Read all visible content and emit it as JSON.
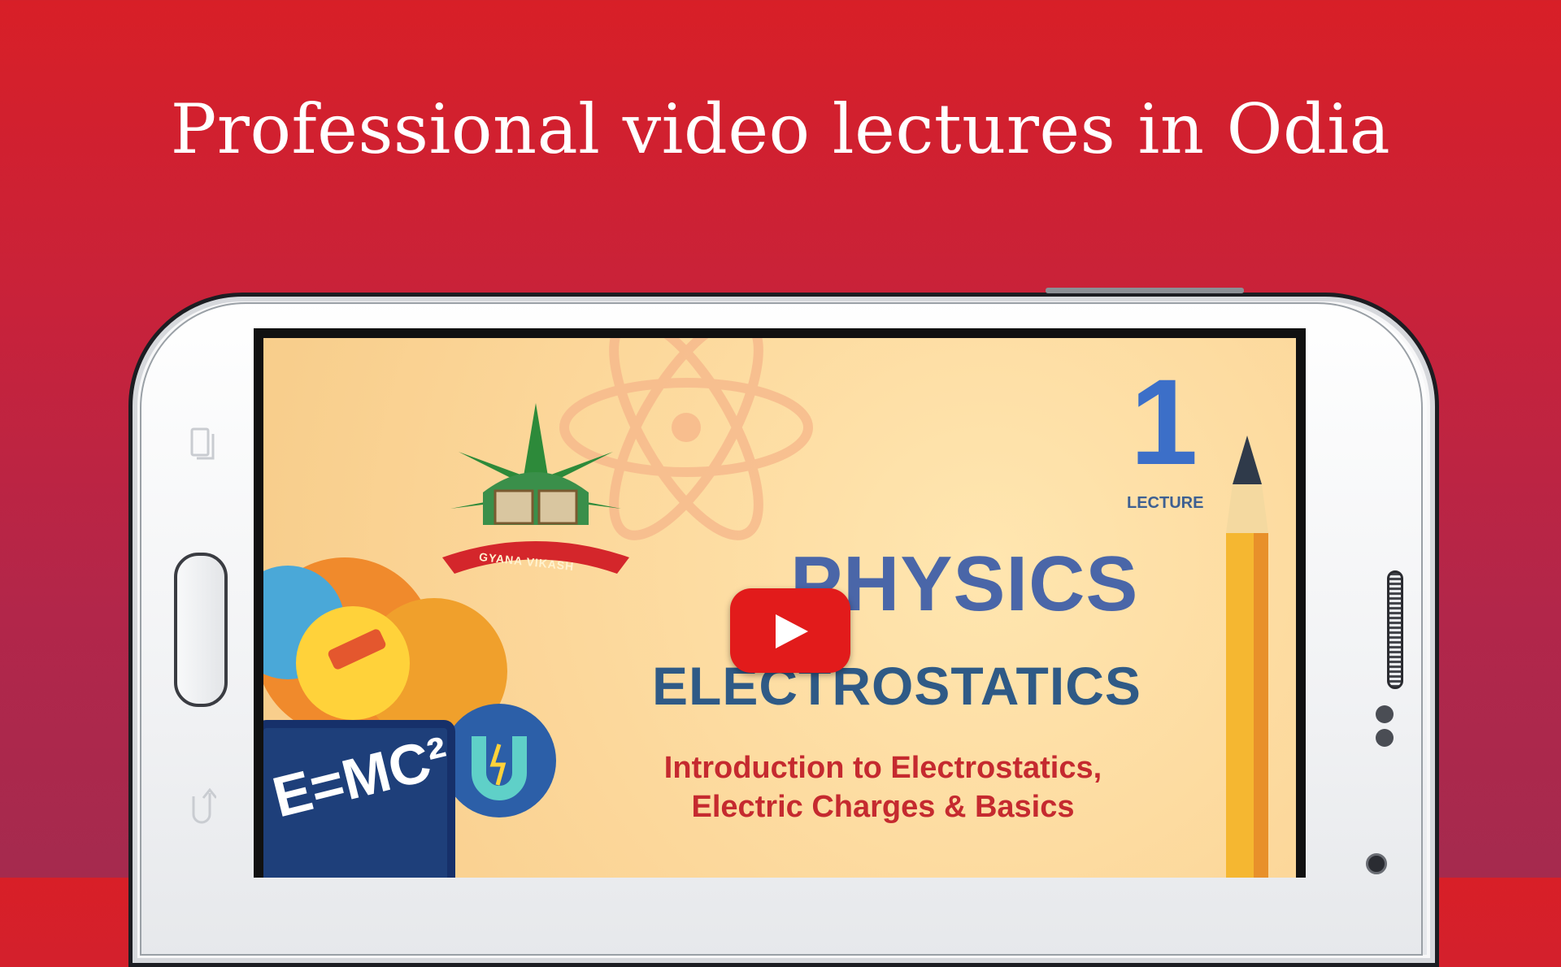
{
  "headline": "Professional video lectures in Odia",
  "video": {
    "lecture_number": "1",
    "lecture_label": "LECTURE",
    "subject": "PHYSICS",
    "topic": "ELECTROSTATICS",
    "lesson_line1": "Introduction to Electrostatics,",
    "lesson_line2": "Electric Charges & Basics",
    "formula": "E=MC²",
    "logo_text": "GYANA VIKASH"
  },
  "icons": {
    "play": "play-icon",
    "recent_apps": "recent-apps-icon",
    "back": "back-icon"
  },
  "colors": {
    "background_top": "#d81f27",
    "background_bottom": "#a52a4e",
    "play_button": "#e21b1b",
    "subject_text": "#4a66a8",
    "topic_text": "#2f5a86",
    "lesson_text": "#c52a2f"
  }
}
